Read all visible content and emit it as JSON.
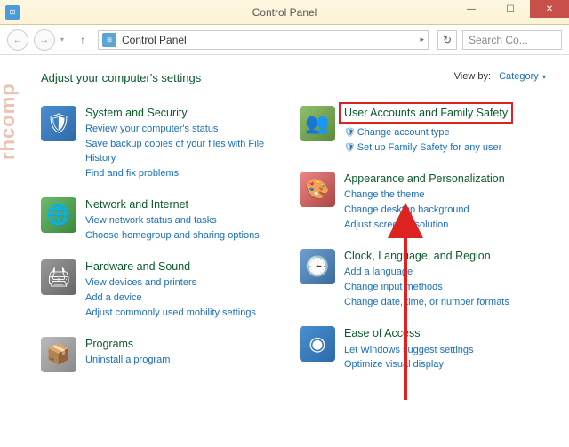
{
  "window": {
    "title": "Control Panel",
    "address": "Control Panel",
    "search_placeholder": "Search Co..."
  },
  "header": {
    "heading": "Adjust your computer's settings",
    "viewby_label": "View by:",
    "viewby_value": "Category"
  },
  "left": [
    {
      "icon": "ic-shield",
      "glyph": "🛡",
      "title": "System and Security",
      "links": [
        "Review your computer's status",
        "Save backup copies of your files with File History",
        "Find and fix problems"
      ]
    },
    {
      "icon": "ic-net",
      "glyph": "🌐",
      "title": "Network and Internet",
      "links": [
        "View network status and tasks",
        "Choose homegroup and sharing options"
      ]
    },
    {
      "icon": "ic-hw",
      "glyph": "🖨",
      "title": "Hardware and Sound",
      "links": [
        "View devices and printers",
        "Add a device",
        "Adjust commonly used mobility settings"
      ]
    },
    {
      "icon": "ic-prog",
      "glyph": "📦",
      "title": "Programs",
      "links": [
        "Uninstall a program"
      ]
    }
  ],
  "right": [
    {
      "icon": "ic-user",
      "glyph": "👥",
      "highlight": true,
      "title": "User Accounts and Family Safety",
      "links": [
        {
          "shield": true,
          "text": "Change account type"
        },
        {
          "shield": true,
          "text": "Set up Family Safety for any user"
        }
      ]
    },
    {
      "icon": "ic-appear",
      "glyph": "🎨",
      "title": "Appearance and Personalization",
      "links": [
        "Change the theme",
        "Change desktop background",
        "Adjust screen resolution"
      ]
    },
    {
      "icon": "ic-clock",
      "glyph": "🕒",
      "title": "Clock, Language, and Region",
      "links": [
        "Add a language",
        "Change input methods",
        "Change date, time, or number formats"
      ]
    },
    {
      "icon": "ic-ease",
      "glyph": "◉",
      "title": "Ease of Access",
      "links": [
        "Let Windows suggest settings",
        "Optimize visual display"
      ]
    }
  ],
  "watermark": "rhcomp"
}
